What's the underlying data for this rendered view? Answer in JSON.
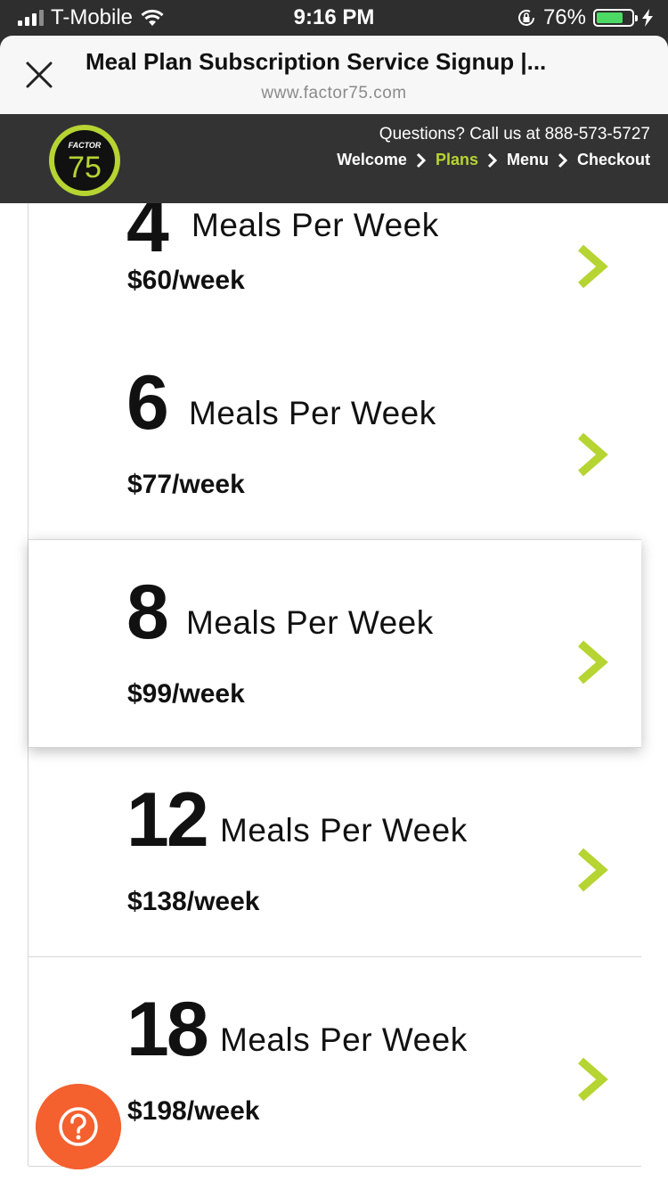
{
  "status_bar": {
    "carrier": "T-Mobile",
    "time": "9:16 PM",
    "battery": "76%",
    "battery_level": 0.76
  },
  "browser": {
    "title": "Meal Plan Subscription Service Signup |...",
    "url": "www.factor75.com"
  },
  "site_header": {
    "logo_top": "FACTOR",
    "logo_number": "75",
    "questions": "Questions? Call us at 888-573-5727",
    "breadcrumbs": [
      "Welcome",
      "Plans",
      "Menu",
      "Checkout"
    ],
    "active_crumb": "Plans"
  },
  "plans": [
    {
      "count": "4",
      "unit": "Meals Per Week",
      "price": "$60/week"
    },
    {
      "count": "6",
      "unit": "Meals Per Week",
      "price": "$77/week"
    },
    {
      "count": "8",
      "unit": "Meals Per Week",
      "price": "$99/week"
    },
    {
      "count": "12",
      "unit": "Meals Per Week",
      "price": "$138/week"
    },
    {
      "count": "18",
      "unit": "Meals Per Week",
      "price": "$198/week"
    }
  ],
  "colors": {
    "accent_green": "#b6d432",
    "help_orange": "#f4602e",
    "header_dark": "#333333"
  },
  "help_button": {
    "icon": "question-icon"
  }
}
